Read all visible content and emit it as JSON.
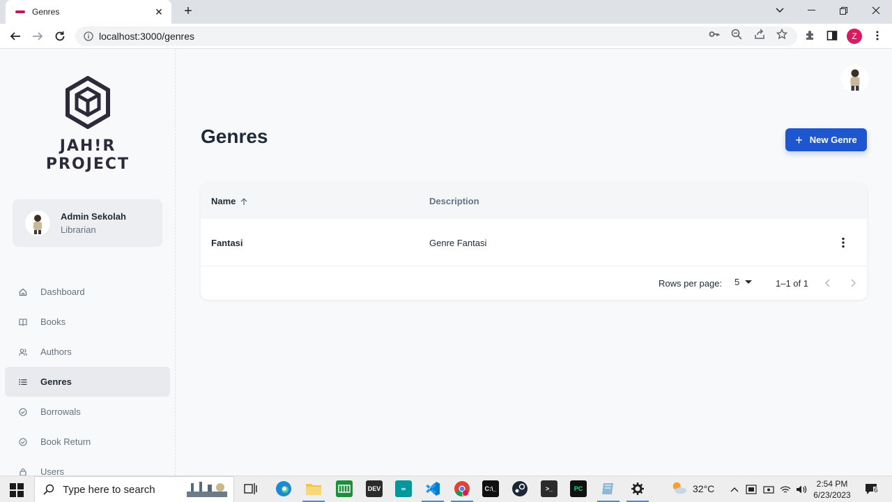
{
  "browser": {
    "tab_title": "Genres",
    "url": "localhost:3000/genres",
    "profile_initial": "Z"
  },
  "sidebar": {
    "logo_line1": "JAH!R",
    "logo_line2": "PROJECT",
    "account": {
      "name": "Admin Sekolah",
      "role": "Librarian"
    },
    "items": [
      {
        "label": "Dashboard",
        "icon": "home-icon"
      },
      {
        "label": "Books",
        "icon": "book-icon"
      },
      {
        "label": "Authors",
        "icon": "people-icon"
      },
      {
        "label": "Genres",
        "icon": "list-icon",
        "active": true
      },
      {
        "label": "Borrowals",
        "icon": "check-circle-icon"
      },
      {
        "label": "Book Return",
        "icon": "check-circle-icon"
      },
      {
        "label": "Users",
        "icon": "lock-icon"
      }
    ]
  },
  "main": {
    "title": "Genres",
    "new_button": "New Genre",
    "table": {
      "col_name": "Name",
      "col_description": "Description",
      "rows": [
        {
          "name": "Fantasi",
          "description": "Genre Fantasi"
        }
      ]
    },
    "pagination": {
      "rows_per_page_label": "Rows per page:",
      "rows_per_page_value": "5",
      "range": "1–1 of 1"
    }
  },
  "taskbar": {
    "search_placeholder": "Type here to search",
    "temperature": "32°C",
    "time": "2:54 PM",
    "date": "6/23/2023",
    "notification_count": "6"
  },
  "colors": {
    "accent": "#1e56d0",
    "profile": "#d81b60"
  }
}
